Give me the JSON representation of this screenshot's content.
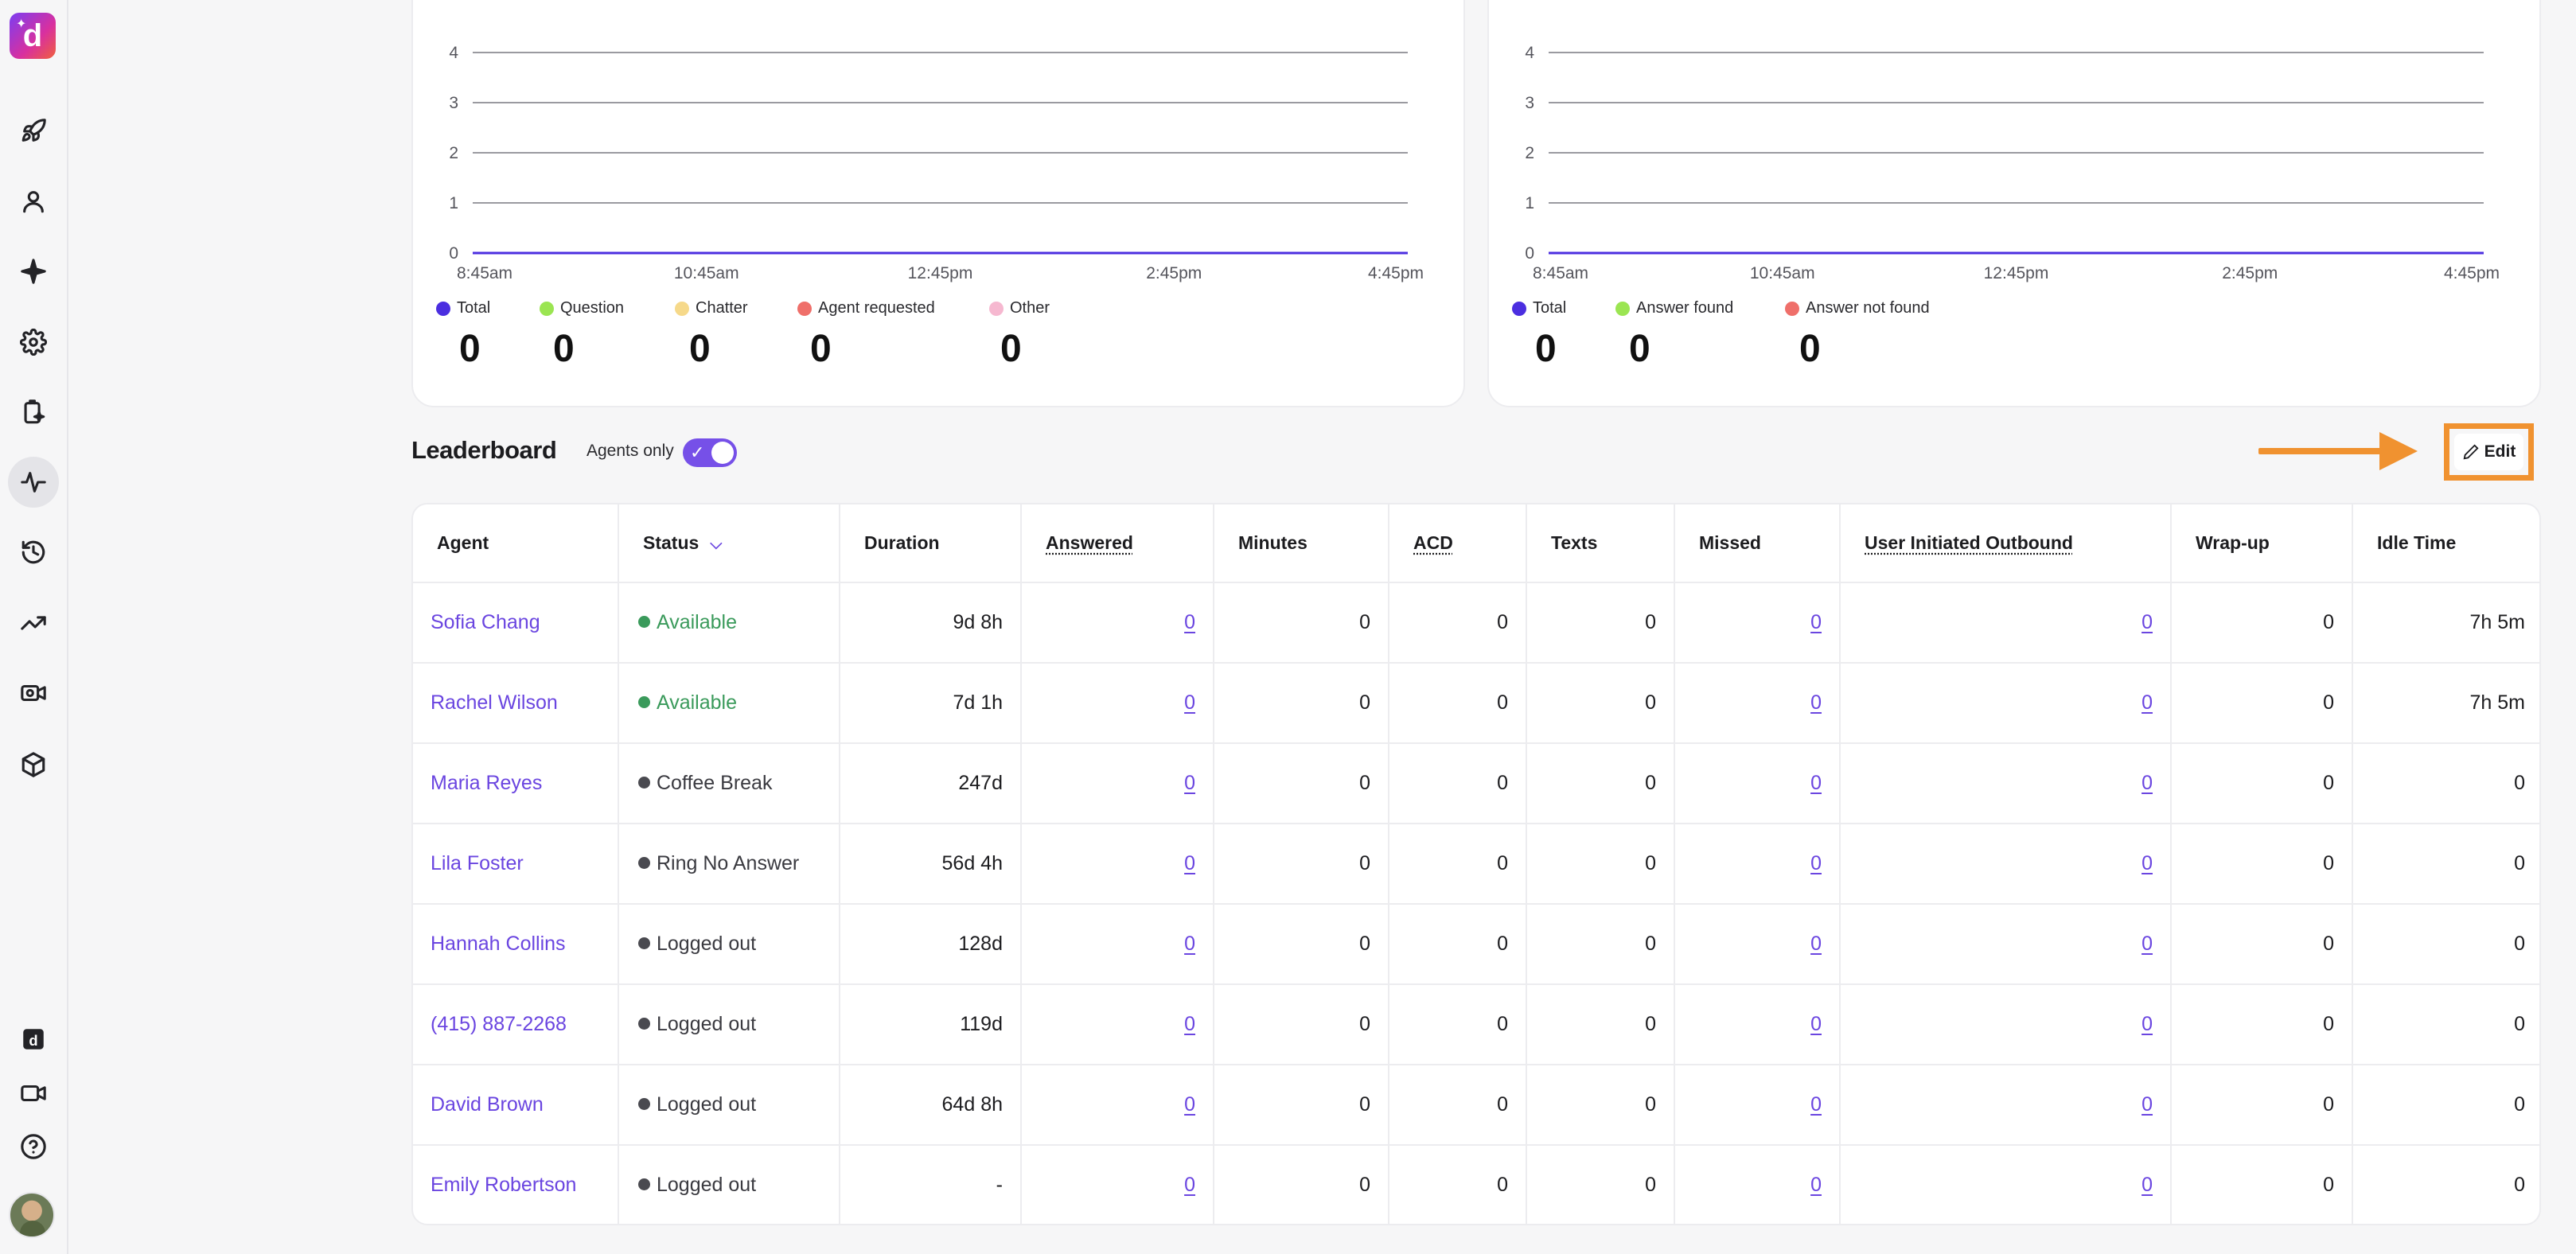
{
  "chart1": {
    "y_ticks": [
      "4",
      "3",
      "2",
      "1",
      "0"
    ],
    "x_ticks": [
      "8:45am",
      "10:45am",
      "12:45pm",
      "2:45pm",
      "4:45pm"
    ],
    "legend": [
      {
        "label": "Total",
        "value": "0",
        "color": "#4b2ee0"
      },
      {
        "label": "Question",
        "value": "0",
        "color": "#9be552"
      },
      {
        "label": "Chatter",
        "value": "0",
        "color": "#f6d98a"
      },
      {
        "label": "Agent requested",
        "value": "0",
        "color": "#ef6f6a"
      },
      {
        "label": "Other",
        "value": "0",
        "color": "#f6b8d0"
      }
    ]
  },
  "chart2": {
    "y_ticks": [
      "4",
      "3",
      "2",
      "1",
      "0"
    ],
    "x_ticks": [
      "8:45am",
      "10:45am",
      "12:45pm",
      "2:45pm",
      "4:45pm"
    ],
    "legend": [
      {
        "label": "Total",
        "value": "0",
        "color": "#4b2ee0"
      },
      {
        "label": "Answer found",
        "value": "0",
        "color": "#9be552"
      },
      {
        "label": "Answer not found",
        "value": "0",
        "color": "#ef6f6a"
      }
    ]
  },
  "chart_data": [
    {
      "type": "line",
      "x": [
        "8:45am",
        "10:45am",
        "12:45pm",
        "2:45pm",
        "4:45pm"
      ],
      "ylim": [
        0,
        4
      ],
      "grid": true,
      "series": [
        {
          "name": "Total",
          "values": [
            0,
            0,
            0,
            0,
            0
          ]
        }
      ]
    },
    {
      "type": "line",
      "x": [
        "8:45am",
        "10:45am",
        "12:45pm",
        "2:45pm",
        "4:45pm"
      ],
      "ylim": [
        0,
        4
      ],
      "grid": true,
      "series": [
        {
          "name": "Total",
          "values": [
            0,
            0,
            0,
            0,
            0
          ]
        }
      ]
    }
  ],
  "leaderboard": {
    "title": "Leaderboard",
    "agents_only_label": "Agents only",
    "agents_only_on": true,
    "edit_label": "Edit",
    "columns": [
      "Agent",
      "Status",
      "Duration",
      "Answered",
      "Minutes",
      "ACD",
      "Texts",
      "Missed",
      "User Initiated Outbound",
      "Wrap-up",
      "Idle Time"
    ],
    "rows": [
      {
        "agent": "Sofia Chang",
        "status": "Available",
        "status_color": "#3a9a5b",
        "duration": "9d 8h",
        "answered": "0",
        "minutes": "0",
        "acd": "0",
        "texts": "0",
        "missed": "0",
        "outbound": "0",
        "wrapup": "0",
        "idle": "7h 5m"
      },
      {
        "agent": "Rachel Wilson",
        "status": "Available",
        "status_color": "#3a9a5b",
        "duration": "7d 1h",
        "answered": "0",
        "minutes": "0",
        "acd": "0",
        "texts": "0",
        "missed": "0",
        "outbound": "0",
        "wrapup": "0",
        "idle": "7h 5m"
      },
      {
        "agent": "Maria Reyes",
        "status": "Coffee Break",
        "status_color": "#4a4a50",
        "duration": "247d",
        "answered": "0",
        "minutes": "0",
        "acd": "0",
        "texts": "0",
        "missed": "0",
        "outbound": "0",
        "wrapup": "0",
        "idle": "0"
      },
      {
        "agent": "Lila Foster",
        "status": "Ring No Answer",
        "status_color": "#4a4a50",
        "duration": "56d 4h",
        "answered": "0",
        "minutes": "0",
        "acd": "0",
        "texts": "0",
        "missed": "0",
        "outbound": "0",
        "wrapup": "0",
        "idle": "0"
      },
      {
        "agent": "Hannah Collins",
        "status": "Logged out",
        "status_color": "#4a4a50",
        "duration": "128d",
        "answered": "0",
        "minutes": "0",
        "acd": "0",
        "texts": "0",
        "missed": "0",
        "outbound": "0",
        "wrapup": "0",
        "idle": "0"
      },
      {
        "agent": "(415) 887-2268",
        "status": "Logged out",
        "status_color": "#4a4a50",
        "duration": "119d",
        "answered": "0",
        "minutes": "0",
        "acd": "0",
        "texts": "0",
        "missed": "0",
        "outbound": "0",
        "wrapup": "0",
        "idle": "0"
      },
      {
        "agent": "David Brown",
        "status": "Logged out",
        "status_color": "#4a4a50",
        "duration": "64d 8h",
        "answered": "0",
        "minutes": "0",
        "acd": "0",
        "texts": "0",
        "missed": "0",
        "outbound": "0",
        "wrapup": "0",
        "idle": "0"
      },
      {
        "agent": "Emily Robertson",
        "status": "Logged out",
        "status_color": "#4a4a50",
        "duration": "-",
        "answered": "0",
        "minutes": "0",
        "acd": "0",
        "texts": "0",
        "missed": "0",
        "outbound": "0",
        "wrapup": "0",
        "idle": "0"
      }
    ]
  },
  "sidebar": {
    "logo_letter": "d",
    "items": [
      {
        "icon": "rocket-icon"
      },
      {
        "icon": "user-icon"
      },
      {
        "icon": "sparkle-icon"
      },
      {
        "icon": "gear-icon"
      },
      {
        "icon": "clipboard-sparkle-icon"
      },
      {
        "icon": "activity-icon",
        "active": true
      },
      {
        "icon": "history-icon"
      },
      {
        "icon": "trending-up-icon"
      },
      {
        "icon": "video-settings-icon"
      },
      {
        "icon": "cube-icon"
      },
      {
        "icon": "dialpad-logo-icon"
      },
      {
        "icon": "video-icon"
      },
      {
        "icon": "help-icon"
      }
    ]
  }
}
